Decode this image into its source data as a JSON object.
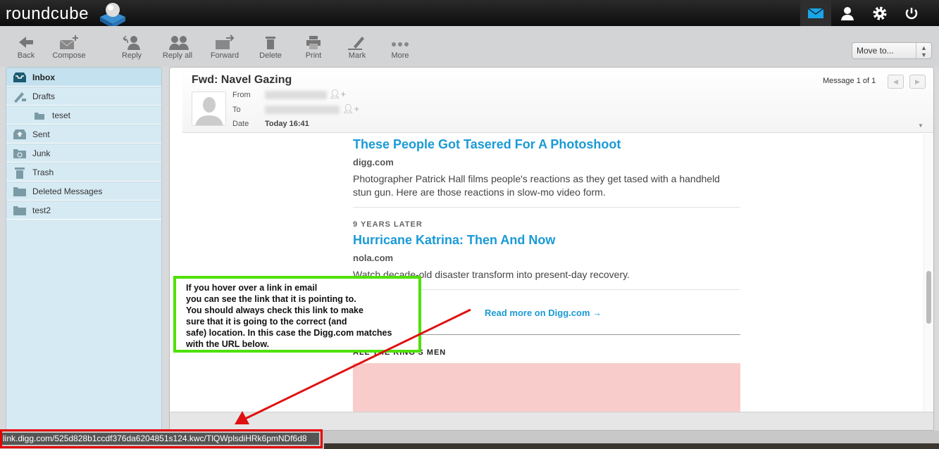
{
  "app": {
    "logo": "roundcube"
  },
  "topnav": [
    {
      "name": "mail-icon",
      "active": true
    },
    {
      "name": "contacts-icon"
    },
    {
      "name": "settings-icon"
    },
    {
      "name": "logout-icon"
    }
  ],
  "toolbar": {
    "back": "Back",
    "compose": "Compose",
    "reply": "Reply",
    "reply_all": "Reply all",
    "forward": "Forward",
    "delete": "Delete",
    "print": "Print",
    "mark": "Mark",
    "more": "More",
    "move_to": "Move to..."
  },
  "folders": [
    {
      "label": "Inbox",
      "icon": "inbox-icon",
      "selected": true
    },
    {
      "label": "Drafts",
      "icon": "drafts-icon"
    },
    {
      "label": "teset",
      "icon": "folder-icon",
      "sub": true
    },
    {
      "label": "Sent",
      "icon": "sent-icon"
    },
    {
      "label": "Junk",
      "icon": "junk-icon"
    },
    {
      "label": "Trash",
      "icon": "trash-icon"
    },
    {
      "label": "Deleted Messages",
      "icon": "folder-icon"
    },
    {
      "label": "test2",
      "icon": "folder-icon"
    }
  ],
  "message": {
    "subject": "Fwd: Navel Gazing",
    "from_label": "From",
    "to_label": "To",
    "date_label": "Date",
    "date": "Today 16:41",
    "count": "Message 1 of 1"
  },
  "body": {
    "item1": {
      "title": "These People Got Tasered For A Photoshoot",
      "source": "digg.com",
      "desc": "Photographer Patrick Hall films people's reactions as they get tased with a handheld stun gun. Here are those reactions in slow-mo video form."
    },
    "item2": {
      "kicker": "9 YEARS LATER",
      "title": "Hurricane Katrina: Then And Now",
      "source": "nola.com",
      "desc": "Watch decade-old disaster transform into present-day recovery."
    },
    "read_more": "Read more on Digg.com →",
    "section": "ALL THE KING'S MEN"
  },
  "annotation": "If you hover over a link in email\nyou can see the link that it is pointing to.\nYou should always check this link to make\nsure that it is going to the correct (and\nsafe) location. In this case the Digg.com matches\nwith the URL below.",
  "status_url": "link.digg.com/525d828b1ccdf376da6204851s124.kwc/TlQWplsdiHRk6pmNDf6d8",
  "colors": {
    "link": "#1a9ad6",
    "annotation_border": "#4fe100",
    "highlight": "#e50000"
  }
}
